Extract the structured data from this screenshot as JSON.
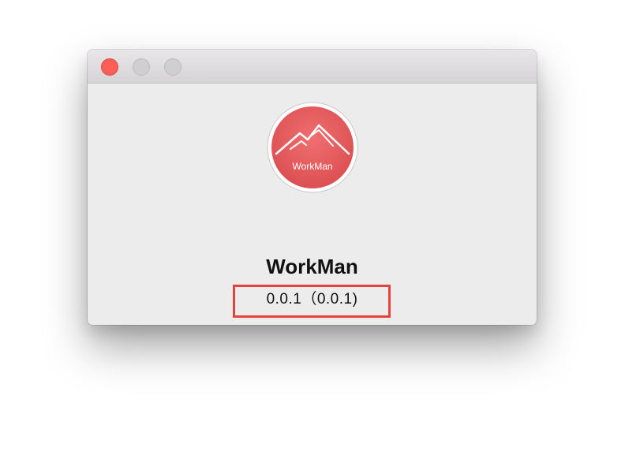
{
  "window": {
    "controls": {
      "close_icon": "close-icon",
      "minimize_icon": "minimize-icon",
      "maximize_icon": "zoom-icon"
    }
  },
  "about": {
    "logo_text": "WorkMan",
    "app_name": "WorkMan",
    "version": "0.0.1（0.0.1)"
  },
  "colors": {
    "close_button": "#fc5f57",
    "logo_red": "#e8585a",
    "highlight_box": "#e8423c",
    "window_bg": "#ececec"
  }
}
